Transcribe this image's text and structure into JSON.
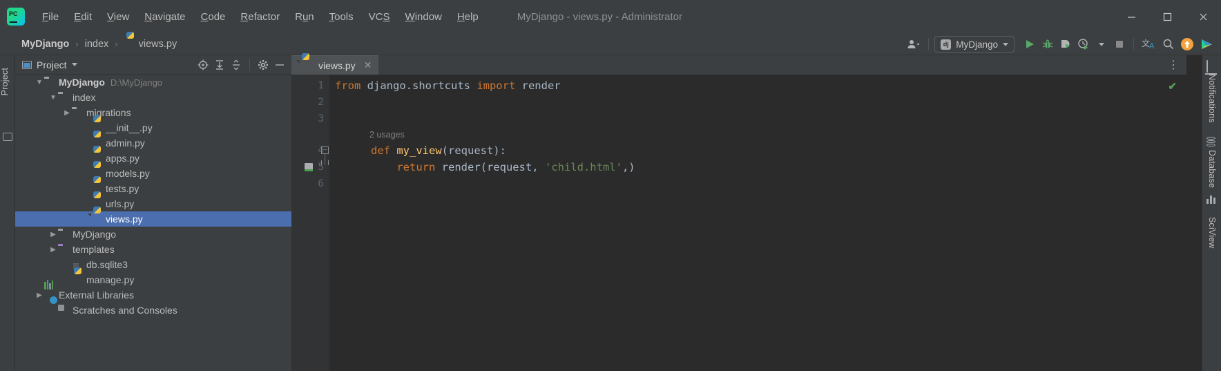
{
  "window": {
    "title": "MyDjango - views.py - Administrator",
    "app_logo": "pycharm-logo",
    "controls": [
      {
        "name": "minimize",
        "glyph": "–"
      },
      {
        "name": "maximize",
        "glyph": "☐"
      },
      {
        "name": "close",
        "glyph": "✕"
      }
    ]
  },
  "menubar": [
    {
      "label": "File",
      "mnemonic": "F"
    },
    {
      "label": "Edit",
      "mnemonic": "E"
    },
    {
      "label": "View",
      "mnemonic": "V"
    },
    {
      "label": "Navigate",
      "mnemonic": "N"
    },
    {
      "label": "Code",
      "mnemonic": "C"
    },
    {
      "label": "Refactor",
      "mnemonic": "R"
    },
    {
      "label": "Run",
      "mnemonic": "u"
    },
    {
      "label": "Tools",
      "mnemonic": "T"
    },
    {
      "label": "VCS",
      "mnemonic": "S"
    },
    {
      "label": "Window",
      "mnemonic": "W"
    },
    {
      "label": "Help",
      "mnemonic": "H"
    }
  ],
  "navbar": {
    "breadcrumb": [
      {
        "label": "MyDjango",
        "icon": "",
        "bold": true
      },
      {
        "label": "index",
        "icon": ""
      },
      {
        "label": "views.py",
        "icon": "python-file-icon"
      }
    ],
    "separator": "›",
    "run_config": {
      "label": "MyDjango",
      "badge": "dj"
    },
    "buttons": [
      {
        "name": "user-account",
        "icon": "user-icon"
      },
      {
        "name": "run",
        "icon": "run-icon"
      },
      {
        "name": "debug",
        "icon": "debug-icon"
      },
      {
        "name": "run-with-coverage",
        "icon": "coverage-icon"
      },
      {
        "name": "profile",
        "icon": "profiler-icon"
      },
      {
        "name": "stop",
        "icon": "stop-icon"
      },
      {
        "name": "translate",
        "icon": "translate-icon"
      },
      {
        "name": "search-everywhere",
        "icon": "search-icon"
      },
      {
        "name": "updates-available",
        "icon": "arrow-up-icon"
      },
      {
        "name": "ide-assistant",
        "icon": "assistant-icon"
      }
    ]
  },
  "left_stripe": {
    "label": "Project"
  },
  "project_panel": {
    "title": "Project",
    "toolbar": [
      {
        "name": "select-opened-file",
        "icon": "target-icon"
      },
      {
        "name": "expand-all",
        "icon": "expand-all-icon"
      },
      {
        "name": "collapse-all",
        "icon": "collapse-all-icon"
      },
      {
        "name": "settings",
        "icon": "gear-icon"
      },
      {
        "name": "hide",
        "icon": "minimize-icon"
      }
    ],
    "tree": [
      {
        "label": "MyDjango",
        "path": "D:\\MyDjango",
        "icon": "folder-icon",
        "indent": 0,
        "arrow": "down",
        "bold": true,
        "selected": false
      },
      {
        "label": "index",
        "path": "",
        "icon": "source-folder-icon",
        "indent": 1,
        "arrow": "down",
        "bold": false,
        "selected": false
      },
      {
        "label": "migrations",
        "path": "",
        "icon": "source-folder-icon",
        "indent": 2,
        "arrow": "right",
        "bold": false,
        "selected": false
      },
      {
        "label": "__init__.py",
        "path": "",
        "icon": "python-file-icon",
        "indent": 3,
        "arrow": "none",
        "bold": false,
        "selected": false
      },
      {
        "label": "admin.py",
        "path": "",
        "icon": "python-file-icon",
        "indent": 3,
        "arrow": "none",
        "bold": false,
        "selected": false
      },
      {
        "label": "apps.py",
        "path": "",
        "icon": "python-file-icon",
        "indent": 3,
        "arrow": "none",
        "bold": false,
        "selected": false
      },
      {
        "label": "models.py",
        "path": "",
        "icon": "python-file-icon",
        "indent": 3,
        "arrow": "none",
        "bold": false,
        "selected": false
      },
      {
        "label": "tests.py",
        "path": "",
        "icon": "python-file-icon",
        "indent": 3,
        "arrow": "none",
        "bold": false,
        "selected": false
      },
      {
        "label": "urls.py",
        "path": "",
        "icon": "python-file-icon",
        "indent": 3,
        "arrow": "none",
        "bold": false,
        "selected": false
      },
      {
        "label": "views.py",
        "path": "",
        "icon": "python-file-icon",
        "indent": 3,
        "arrow": "none",
        "bold": false,
        "selected": true
      },
      {
        "label": "MyDjango",
        "path": "",
        "icon": "source-folder-icon",
        "indent": 1,
        "arrow": "right",
        "bold": false,
        "selected": false
      },
      {
        "label": "templates",
        "path": "",
        "icon": "templates-folder-icon",
        "indent": 1,
        "arrow": "right",
        "bold": false,
        "selected": false
      },
      {
        "label": "db.sqlite3",
        "path": "",
        "icon": "database-file-icon",
        "indent": 2,
        "arrow": "none",
        "bold": false,
        "selected": false
      },
      {
        "label": "manage.py",
        "path": "",
        "icon": "python-file-icon",
        "indent": 2,
        "arrow": "none",
        "bold": false,
        "selected": false
      },
      {
        "label": "External Libraries",
        "path": "",
        "icon": "libraries-icon",
        "indent": 0,
        "arrow": "right",
        "bold": false,
        "selected": false
      },
      {
        "label": "Scratches and Consoles",
        "path": "",
        "icon": "scratches-icon",
        "indent": 1,
        "arrow": "none",
        "bold": false,
        "selected": false
      }
    ]
  },
  "editor": {
    "tabs": [
      {
        "label": "views.py",
        "icon": "python-file-icon",
        "active": true,
        "close": "✕"
      }
    ],
    "options_glyph": "⋮",
    "inspection_status": "✔",
    "line_numbers": [
      "1",
      "2",
      "3",
      "4",
      "5",
      "6"
    ],
    "lines": [
      {
        "num": "1",
        "tokens": [
          {
            "t": "from ",
            "c": "kw"
          },
          {
            "t": "django.shortcuts ",
            "c": "id"
          },
          {
            "t": "import ",
            "c": "kw"
          },
          {
            "t": "render",
            "c": "id"
          }
        ]
      },
      {
        "num": "2",
        "tokens": []
      },
      {
        "num": "3",
        "tokens": []
      },
      {
        "num": "4",
        "tokens": [
          {
            "t": "def ",
            "c": "kw"
          },
          {
            "t": "my_view",
            "c": "fn"
          },
          {
            "t": "(request):",
            "c": "id"
          }
        ]
      },
      {
        "num": "5",
        "tokens": [
          {
            "t": "    return ",
            "c": "kw"
          },
          {
            "t": "render(request, ",
            "c": "id"
          },
          {
            "t": "'child.html'",
            "c": "str"
          },
          {
            "t": ",)",
            "c": "id"
          }
        ]
      },
      {
        "num": "6",
        "tokens": []
      }
    ],
    "inlay_hint": "2 usages",
    "code_text_line1": "from django.shortcuts import render",
    "code_text_line4": "def my_view(request):",
    "code_text_line5": "    return render(request, 'child.html',)"
  },
  "right_stripe": [
    {
      "label": "Notifications",
      "icon": "bell-icon"
    },
    {
      "label": "Database",
      "icon": "database-icon"
    },
    {
      "label": "SciView",
      "icon": "sciview-icon"
    }
  ],
  "colors": {
    "accent_selection": "#4b6eaf",
    "editor_bg": "#2b2b2b",
    "panel_bg": "#3c3f41",
    "keyword": "#cc7832",
    "string": "#6a8759",
    "function": "#ffc66d",
    "identifier": "#a9b7c6",
    "run_green": "#59a869"
  }
}
